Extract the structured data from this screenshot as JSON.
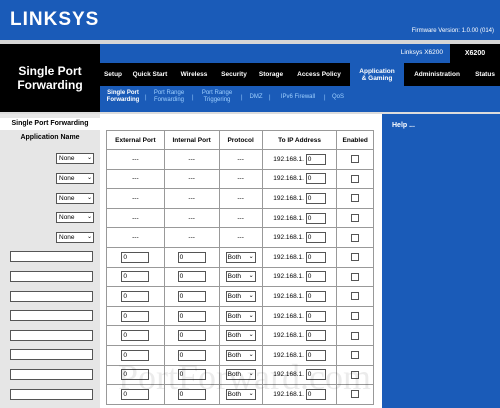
{
  "brand": {
    "logo": "LINKSYS",
    "firmware": "Firmware Version: 1.0.00 (014)"
  },
  "product": {
    "name": "Linksys X6200",
    "model": "X6200"
  },
  "section": {
    "title_line1": "Single Port",
    "title_line2": "Forwarding"
  },
  "tabs": [
    {
      "label": "Setup"
    },
    {
      "label": "Quick Start"
    },
    {
      "label": "Wireless"
    },
    {
      "label": "Security"
    },
    {
      "label": "Storage"
    },
    {
      "label": "Access Policy"
    },
    {
      "label": "Application & Gaming",
      "line1": "Application",
      "line2": "& Gaming",
      "active": true
    },
    {
      "label": "Administration"
    },
    {
      "label": "Status"
    }
  ],
  "subtabs": [
    {
      "line1": "Single Port",
      "line2": "Forwarding",
      "active": true
    },
    {
      "line1": "Port Range",
      "line2": "Forwarding"
    },
    {
      "line1": "Port Range",
      "line2": "Triggering"
    },
    {
      "line1": "DMZ",
      "line2": ""
    },
    {
      "line1": "IPv6 Firewall",
      "line2": ""
    },
    {
      "line1": "QoS",
      "line2": ""
    }
  ],
  "left": {
    "heading": "Single Port Forwarding",
    "app_name_header": "Application Name",
    "preset_value": "None"
  },
  "table": {
    "headers": {
      "ext": "External Port",
      "int": "Internal Port",
      "proto": "Protocol",
      "ip": "To IP Address",
      "enabled": "Enabled"
    },
    "preset_dash": "---",
    "ip_prefix": "192.168.1.",
    "ip_value": "0",
    "port_value": "0",
    "proto_value": "Both"
  },
  "help": {
    "title": "Help ..."
  },
  "watermark": "PortForward.com"
}
